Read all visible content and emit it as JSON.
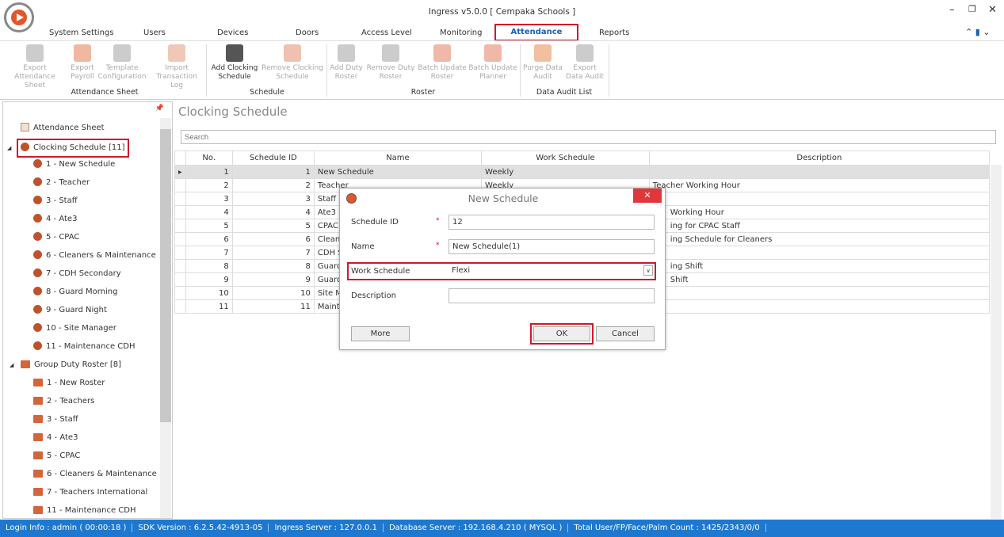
{
  "window": {
    "title": "Ingress v5.0.0 [ Cempaka Schools ]"
  },
  "tabs": [
    "System Settings",
    "Users",
    "Devices",
    "Doors",
    "Access Level",
    "Monitoring",
    "Attendance",
    "Reports"
  ],
  "active_tab": "Attendance",
  "ribbon": {
    "buttons": [
      {
        "l1": "Export",
        "l2": "Attendance Sheet",
        "enabled": false
      },
      {
        "l1": "Export",
        "l2": "Payroll",
        "enabled": false
      },
      {
        "l1": "Template",
        "l2": "Configuration",
        "enabled": false
      },
      {
        "l1": "Import",
        "l2": "Transaction Log",
        "enabled": false
      },
      {
        "l1": "Add Clocking",
        "l2": "Schedule",
        "enabled": true
      },
      {
        "l1": "Remove Clocking",
        "l2": "Schedule",
        "enabled": false
      },
      {
        "l1": "Add Duty",
        "l2": "Roster",
        "enabled": false
      },
      {
        "l1": "Remove Duty",
        "l2": "Roster",
        "enabled": false
      },
      {
        "l1": "Batch Update",
        "l2": "Roster",
        "enabled": false
      },
      {
        "l1": "Batch Update",
        "l2": "Planner",
        "enabled": false
      },
      {
        "l1": "Purge Data",
        "l2": "Audit",
        "enabled": false
      },
      {
        "l1": "Export",
        "l2": "Data Audit",
        "enabled": false
      }
    ],
    "groups": [
      "Attendance Sheet",
      "Schedule",
      "Roster",
      "Data Audit List"
    ]
  },
  "tree": {
    "attendance_sheet": "Attendance Sheet",
    "clocking": "Clocking Schedule [11]",
    "clocking_items": [
      "1 - New Schedule",
      "2 - Teacher",
      "3 - Staff",
      "4 - Ate3",
      "5 - CPAC",
      "6 - Cleaners & Maintenance",
      "7 - CDH Secondary",
      "8 - Guard Morning",
      "9 - Guard Night",
      "10 - Site Manager",
      "11 - Maintenance CDH"
    ],
    "roster": "Group Duty Roster [8]",
    "roster_items": [
      "1 - New Roster",
      "2 - Teachers",
      "3 - Staff",
      "4 - Ate3",
      "5 - CPAC",
      "6 - Cleaners & Maintenance",
      "7 - Teachers International",
      "11 - Maintenance CDH"
    ]
  },
  "main": {
    "title": "Clocking Schedule",
    "search_placeholder": "Search",
    "columns": [
      "No.",
      "Schedule ID",
      "Name",
      "Work Schedule",
      "Description"
    ],
    "rows": [
      [
        "1",
        "1",
        "New Schedule",
        "Weekly",
        ""
      ],
      [
        "2",
        "2",
        "Teacher",
        "Weekly",
        "Teacher Working Hour"
      ],
      [
        "3",
        "3",
        "Staff",
        "",
        ""
      ],
      [
        "4",
        "4",
        "Ate3",
        "",
        "Working Hour"
      ],
      [
        "5",
        "5",
        "CPAC",
        "",
        "ing for CPAC Staff"
      ],
      [
        "6",
        "6",
        "Cleaners",
        "",
        "ing Schedule for Cleaners"
      ],
      [
        "7",
        "7",
        "CDH Secondary",
        "",
        ""
      ],
      [
        "8",
        "8",
        "Guard Morning",
        "",
        "ing Shift"
      ],
      [
        "9",
        "9",
        "Guard Night",
        "",
        "Shift"
      ],
      [
        "10",
        "10",
        "Site Manager",
        "",
        ""
      ],
      [
        "11",
        "11",
        "Maintenance CDH",
        "",
        ""
      ]
    ]
  },
  "dialog": {
    "title": "New Schedule",
    "schedule_id_label": "Schedule ID",
    "schedule_id": "12",
    "name_label": "Name",
    "name": "New Schedule(1)",
    "work_schedule_label": "Work Schedule",
    "work_schedule": "Flexi",
    "description_label": "Description",
    "description": "",
    "more": "More",
    "ok": "OK",
    "cancel": "Cancel",
    "required": "*"
  },
  "status": [
    "Login Info : admin ( 00:00:18 )",
    "SDK Version : 6.2.5.42-4913-05",
    "Ingress Server : 127.0.0.1",
    "Database Server : 192.168.4.210 ( MYSQL )",
    "Total User/FP/Face/Palm Count : 1425/2343/0/0"
  ],
  "colors": {
    "accent": "#1e78cf",
    "highlight": "#d0182a",
    "icon": "#e2562b"
  }
}
